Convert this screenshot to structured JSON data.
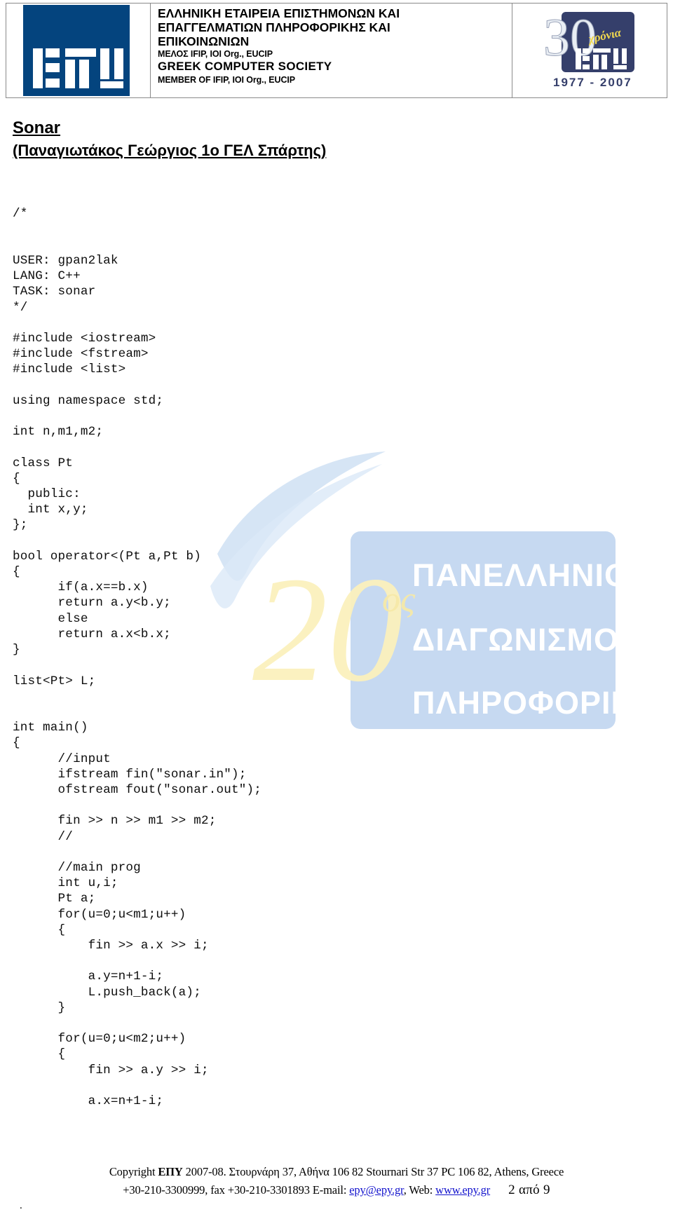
{
  "header": {
    "org_lines": [
      "ΕΛΛΗΝΙΚΗ ΕΤΑΙΡΕΙΑ ΕΠΙΣΤΗΜΟΝΩΝ ΚΑΙ",
      "ΕΠΑΓΓΕΛΜΑΤΙΩΝ ΠΛΗΡΟΦΟΡΙΚΗΣ ΚΑΙ",
      "ΕΠΙΚΟΙΝΩΝΙΩΝ"
    ],
    "membership_gr": "ΜΕΛΟΣ IFIP, IOI Org., EUCIP",
    "org_en": "GREEK COMPUTER SOCIETY",
    "membership_en": "MEMBER OF IFIP, IOI Org., EUCIP",
    "logo_text": "ΕΠΥ",
    "anniversary": {
      "number": "30",
      "word": "χρόνια",
      "years": "1977 - 2007"
    },
    "brand_color": "#04447e"
  },
  "watermark": {
    "number": "20",
    "ordinal": "ος",
    "line1": "ΠΑΝΕΛΛΗΝΙΟΣ",
    "line2": "ΔΙΑΓΩΝΙΣΜΟΣ",
    "line3": "ΠΛΗΡΟΦΟΡΙΚΗΣ",
    "box_color": "#c6d9f1",
    "number_color": "#fdf3c0"
  },
  "title": {
    "name": "Sonar",
    "author": "(Παναγιωτάκος Γεώργιος 1ο ΓΕΛ Σπάρτης)"
  },
  "code": {
    "comment_open": "/*",
    "lines": [
      "USER: gpan2lak",
      "LANG: C++",
      "TASK: sonar",
      "*/",
      "",
      "#include <iostream>",
      "#include <fstream>",
      "#include <list>",
      "",
      "using namespace std;",
      "",
      "int n,m1,m2;",
      "",
      "class Pt",
      "{",
      "  public:",
      "  int x,y;",
      "};",
      "",
      "bool operator<(Pt a,Pt b)",
      "{",
      "      if(a.x==b.x)",
      "      return a.y<b.y;",
      "      else",
      "      return a.x<b.x;",
      "}",
      "",
      "list<Pt> L;",
      "",
      "",
      "int main()",
      "{",
      "      //input",
      "      ifstream fin(\"sonar.in\");",
      "      ofstream fout(\"sonar.out\");",
      "",
      "      fin >> n >> m1 >> m2;",
      "      //",
      "",
      "      //main prog",
      "      int u,i;",
      "      Pt a;",
      "      for(u=0;u<m1;u++)",
      "      {",
      "          fin >> a.x >> i;",
      "",
      "          a.y=n+1-i;",
      "          L.push_back(a);",
      "      }",
      "",
      "      for(u=0;u<m2;u++)",
      "      {",
      "          fin >> a.y >> i;",
      "",
      "          a.x=n+1-i;"
    ]
  },
  "footer": {
    "copyright_prefix": "Copyright ",
    "copyright_bold": "ΕΠΥ",
    "copyright_rest": " 2007-08. Στουρνάρη 37, Αθήνα 106 82 Stournari Str 37 PC 106 82, Athens, Greece",
    "phone": "+30-210-3300999, fax +30-210-3301893 E-mail: ",
    "email": "epy@epy.gr",
    "web_label": ", Web: ",
    "web": "www.epy.gr",
    "page": "2 από 9",
    "stray_dot": "."
  }
}
